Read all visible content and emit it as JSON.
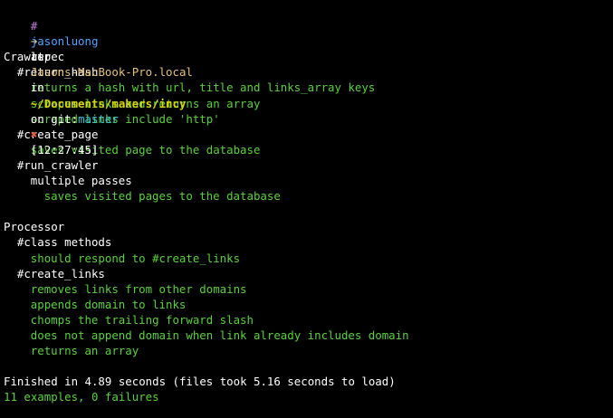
{
  "prompt": {
    "hash": "#",
    "user": "jasonluong",
    "at": "at",
    "host": "Jasons-MacBook-Pro.local",
    "in": "in",
    "path": "~/Documents/makers/incy",
    "on": "on",
    "git_label": "git:",
    "branch": "master",
    "status_icon": "✖",
    "time": "[12:27:45]"
  },
  "command": {
    "arrow": "➜",
    "text": "rspec"
  },
  "output": [
    {
      "text": "",
      "indent": 0,
      "kind": "blank"
    },
    {
      "text": "Crawler",
      "indent": 0,
      "kind": "group"
    },
    {
      "text": "#return_hash",
      "indent": 1,
      "kind": "group"
    },
    {
      "text": "returns a hash with url, title and links_array keys",
      "indent": 2,
      "kind": "pass"
    },
    {
      "text": "scrapes links and returns an array",
      "indent": 2,
      "kind": "pass"
    },
    {
      "text": "scraped links include 'http'",
      "indent": 2,
      "kind": "pass"
    },
    {
      "text": "#create_page",
      "indent": 1,
      "kind": "group"
    },
    {
      "text": "saves visited page to the database",
      "indent": 2,
      "kind": "pass"
    },
    {
      "text": "#run_crawler",
      "indent": 1,
      "kind": "group"
    },
    {
      "text": "multiple passes",
      "indent": 2,
      "kind": "group"
    },
    {
      "text": "saves visited pages to the database",
      "indent": 3,
      "kind": "pass"
    },
    {
      "text": "",
      "indent": 0,
      "kind": "blank"
    },
    {
      "text": "Processor",
      "indent": 0,
      "kind": "group"
    },
    {
      "text": "#class methods",
      "indent": 1,
      "kind": "group"
    },
    {
      "text": "should respond to #create_links",
      "indent": 2,
      "kind": "pass"
    },
    {
      "text": "#create_links",
      "indent": 1,
      "kind": "group"
    },
    {
      "text": "removes links from other domains",
      "indent": 2,
      "kind": "pass"
    },
    {
      "text": "appends domain to links",
      "indent": 2,
      "kind": "pass"
    },
    {
      "text": "chomps the trailing forward slash",
      "indent": 2,
      "kind": "pass"
    },
    {
      "text": "does not append domain when link already includes domain",
      "indent": 2,
      "kind": "pass"
    },
    {
      "text": "returns an array",
      "indent": 2,
      "kind": "pass"
    },
    {
      "text": "",
      "indent": 0,
      "kind": "blank"
    },
    {
      "text": "Finished in 4.89 seconds (files took 5.16 seconds to load)",
      "indent": 0,
      "kind": "summary-time"
    },
    {
      "text": "11 examples, 0 failures",
      "indent": 0,
      "kind": "summary-result"
    }
  ],
  "colors": {
    "background": "#000000",
    "pass": "#5bd03d",
    "user": "#4fa3ff",
    "host": "#e5c07b",
    "path": "#d7d700",
    "branch": "#36c5d6",
    "error": "#e45649"
  }
}
